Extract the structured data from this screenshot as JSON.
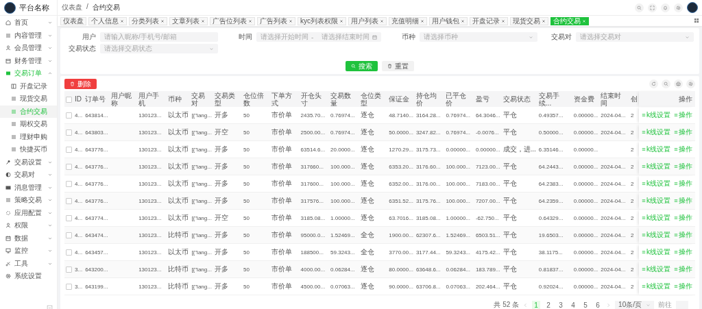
{
  "brand": {
    "name": "平台名称"
  },
  "sidebar": {
    "items": [
      {
        "label": "首页",
        "expanded": false
      },
      {
        "label": "内容管理",
        "expanded": false
      },
      {
        "label": "会员管理",
        "expanded": false
      },
      {
        "label": "财务管理",
        "expanded": false
      },
      {
        "label": "交易订单",
        "expanded": true,
        "children": [
          {
            "label": "开盘记录",
            "selected": false
          },
          {
            "label": "现货交易",
            "selected": false
          },
          {
            "label": "合约交易",
            "selected": true
          },
          {
            "label": "期权交易",
            "selected": false
          },
          {
            "label": "理财申购",
            "selected": false
          },
          {
            "label": "快捷买币",
            "selected": false
          }
        ]
      },
      {
        "label": "交易设置",
        "expanded": false
      },
      {
        "label": "交易对",
        "expanded": false
      },
      {
        "label": "消息管理",
        "expanded": false
      },
      {
        "label": "策略交易",
        "expanded": false
      },
      {
        "label": "应用配置",
        "expanded": false
      },
      {
        "label": "权限",
        "expanded": false
      },
      {
        "label": "数据",
        "expanded": false
      },
      {
        "label": "监控",
        "expanded": false
      },
      {
        "label": "工具",
        "expanded": false
      },
      {
        "label": "系统设置"
      }
    ]
  },
  "breadcrumb": {
    "items": [
      "仪表盘",
      "合约交易"
    ],
    "separator": "/"
  },
  "tabs": [
    {
      "label": "仪表盘",
      "closable": false,
      "selected": false
    },
    {
      "label": "个人信息",
      "closable": true,
      "selected": false
    },
    {
      "label": "分类列表",
      "closable": true,
      "selected": false
    },
    {
      "label": "文章列表",
      "closable": true,
      "selected": false
    },
    {
      "label": "广告位列表",
      "closable": true,
      "selected": false
    },
    {
      "label": "广告列表",
      "closable": true,
      "selected": false
    },
    {
      "label": "kyc列表权限",
      "closable": true,
      "selected": false
    },
    {
      "label": "用户列表",
      "closable": true,
      "selected": false
    },
    {
      "label": "充值明细",
      "closable": true,
      "selected": false
    },
    {
      "label": "用户钱包",
      "closable": true,
      "selected": false
    },
    {
      "label": "开盘记录",
      "closable": true,
      "selected": false
    },
    {
      "label": "现货交易",
      "closable": true,
      "selected": false
    },
    {
      "label": "合约交易",
      "closable": true,
      "selected": true
    }
  ],
  "filters": [
    {
      "kind": "text",
      "label": "用户",
      "placeholder": "请输入昵称/手机号/邮箱"
    },
    {
      "kind": "daterange",
      "label": "时间",
      "placeholder": "请选择开始时间",
      "placeholder_end": "请选择结束时间",
      "separator": "-"
    },
    {
      "kind": "select",
      "label": "币种",
      "placeholder": "请选择币种"
    },
    {
      "kind": "select",
      "label": "交易对",
      "placeholder": "请选择交易对"
    },
    {
      "kind": "select",
      "label": "交易状态",
      "placeholder": "请选择交易状态"
    }
  ],
  "search_button": "搜索",
  "reset_button": "重置",
  "delete_button": "删除",
  "table": {
    "select_all": false,
    "columns": [
      "ID",
      "订单号",
      "用户昵称",
      "用户手机",
      "币种",
      "交易对",
      "交易类型",
      "仓位倍数",
      "下单方式",
      "开仓头寸",
      "交易数量",
      "仓位类型",
      "保证金",
      "持仓均价",
      "已平仓价",
      "盈亏",
      "交易状态",
      "交易手续...",
      "资金费",
      "结束时间",
      "创"
    ],
    "action_column": "操作",
    "rows": [
      {
        "selected": false,
        "cells": [
          "4...",
          "643814...",
          "",
          "130123...",
          "以太币",
          "[{\"lang...",
          "开多",
          "50",
          "市价单",
          "2435.70...",
          "0.76974...",
          "逐仓",
          "48.7140...",
          "3164.28...",
          "0.76974...",
          "64.3046...",
          "平仓",
          "0.49357...",
          "0.00000...",
          "2024-04...",
          "2"
        ],
        "actions": [
          "k线设置",
          "操作"
        ]
      },
      {
        "selected": false,
        "cells": [
          "4...",
          "643803...",
          "",
          "130123...",
          "以太币",
          "[{\"lang...",
          "开空",
          "50",
          "市价单",
          "2500.00...",
          "0.76974...",
          "逐仓",
          "50.0000...",
          "3247.82...",
          "0.76974...",
          "-0.0076...",
          "平仓",
          "0.50000...",
          "0.00000...",
          "2024-04...",
          "2"
        ],
        "actions": [
          "k线设置",
          "操作"
        ]
      },
      {
        "selected": false,
        "cells": [
          "4...",
          "643776...",
          "",
          "130123...",
          "以太币",
          "[{\"lang...",
          "开多",
          "50",
          "市价单",
          "63514.6...",
          "20.0000...",
          "逐仓",
          "1270.29...",
          "3175.73...",
          "0.00000...",
          "0.00000...",
          "成交，进...",
          "6.35146...",
          "0.00000...",
          "",
          "2"
        ],
        "actions": [
          "k线设置",
          "操作"
        ]
      },
      {
        "selected": false,
        "cells": [
          "4...",
          "643776...",
          "",
          "130123...",
          "以太币",
          "[{\"lang...",
          "开多",
          "50",
          "市价单",
          "317660...",
          "100.000...",
          "逐仓",
          "6353.20...",
          "3176.60...",
          "100.000...",
          "7123.00...",
          "平仓",
          "64.2443...",
          "0.00000...",
          "2024-04...",
          "2"
        ],
        "actions": [
          "k线设置",
          "操作"
        ]
      },
      {
        "selected": false,
        "cells": [
          "4...",
          "643776...",
          "",
          "130123...",
          "以太币",
          "[{\"lang...",
          "开多",
          "50",
          "市价单",
          "317600...",
          "100.000...",
          "逐仓",
          "6352.00...",
          "3176.00...",
          "100.000...",
          "7183.00...",
          "平仓",
          "64.2383...",
          "0.00000...",
          "2024-04...",
          "2"
        ],
        "actions": [
          "k线设置",
          "操作"
        ]
      },
      {
        "selected": false,
        "cells": [
          "4...",
          "643776...",
          "",
          "130123...",
          "以太币",
          "[{\"lang...",
          "开多",
          "50",
          "市价单",
          "317576...",
          "100.000...",
          "逐仓",
          "6351.52...",
          "3175.76...",
          "100.000...",
          "7207.00...",
          "平仓",
          "64.2359...",
          "0.00000...",
          "2024-04...",
          "2"
        ],
        "actions": [
          "k线设置",
          "操作"
        ]
      },
      {
        "selected": false,
        "cells": [
          "4...",
          "643774...",
          "",
          "130123...",
          "以太币",
          "[{\"lang...",
          "开空",
          "50",
          "市价单",
          "3185.08...",
          "1.00000...",
          "逐仓",
          "63.7016...",
          "3185.08...",
          "1.00000...",
          "-62.750...",
          "平仓",
          "0.64329...",
          "0.00000...",
          "2024-04...",
          "2"
        ],
        "actions": [
          "k线设置",
          "操作"
        ]
      },
      {
        "selected": false,
        "cells": [
          "4...",
          "643474...",
          "",
          "130123...",
          "比特币",
          "[{\"lang...",
          "开多",
          "50",
          "市价单",
          "95000.0...",
          "1.52469...",
          "全仓",
          "1900.00...",
          "62307.6...",
          "1.52469...",
          "6503.51...",
          "平仓",
          "19.6503...",
          "0.00000...",
          "2024-04...",
          "2"
        ],
        "actions": [
          "k线设置",
          "操作"
        ]
      },
      {
        "selected": false,
        "cells": [
          "4...",
          "643457...",
          "",
          "130123...",
          "以太币",
          "[{\"lang...",
          "开多",
          "50",
          "市价单",
          "188500...",
          "59.3243...",
          "全仓",
          "3770.00...",
          "3177.44...",
          "59.3243...",
          "4175.42...",
          "平仓",
          "38.1175...",
          "0.00000...",
          "2024-04...",
          "2"
        ],
        "actions": [
          "k线设置",
          "操作"
        ]
      },
      {
        "selected": false,
        "cells": [
          "3...",
          "643200...",
          "",
          "130123...",
          "比特币",
          "[{\"lang...",
          "开多",
          "50",
          "市价单",
          "4000.00...",
          "0.06284...",
          "逐仓",
          "80.0000...",
          "63648.6...",
          "0.06284...",
          "183.789...",
          "平仓",
          "0.81837...",
          "0.00000...",
          "2024-04...",
          "2"
        ],
        "actions": [
          "k线设置",
          "操作"
        ]
      },
      {
        "selected": false,
        "cells": [
          "3...",
          "643199...",
          "",
          "130123...",
          "比特币",
          "[{\"lang...",
          "开多",
          "50",
          "市价单",
          "4500.00...",
          "0.07063...",
          "逐仓",
          "90.0000...",
          "63706.8...",
          "0.07063...",
          "202.464...",
          "平仓",
          "0.92024...",
          "0.00000...",
          "2024-04...",
          "2"
        ],
        "actions": [
          "k线设置",
          "操作"
        ]
      }
    ]
  },
  "pagination": {
    "total": "共 52 条",
    "pages": [
      {
        "label": "1",
        "selected": true
      },
      {
        "label": "2",
        "selected": false
      },
      {
        "label": "3",
        "selected": false
      },
      {
        "label": "4",
        "selected": false
      },
      {
        "label": "5",
        "selected": false
      },
      {
        "label": "6",
        "selected": false
      }
    ],
    "page_size": "10条/页",
    "goto_label": "前往"
  }
}
